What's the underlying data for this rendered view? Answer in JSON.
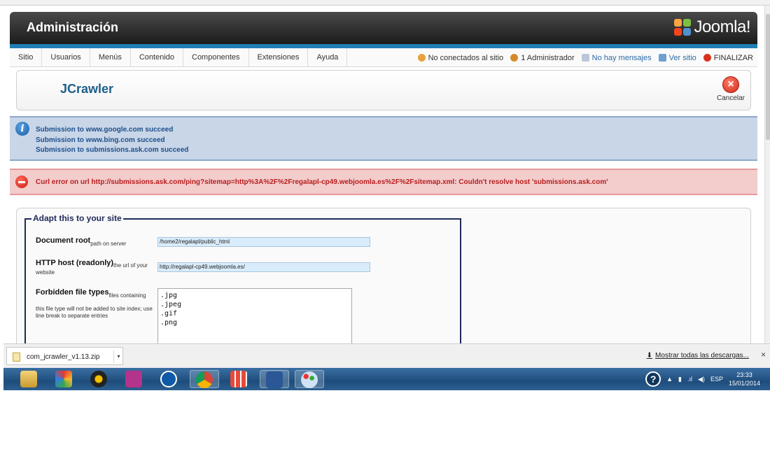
{
  "header": {
    "title": "Administración",
    "logo_text": "Joomla!"
  },
  "menu": {
    "items": [
      "Sitio",
      "Usuarios",
      "Menús",
      "Contenido",
      "Componentes",
      "Extensiones",
      "Ayuda"
    ]
  },
  "status": {
    "offline_users": "No conectados al sitio",
    "admins": "1 Administrador",
    "messages": "No hay mensajes",
    "view_site": "Ver sitio",
    "logout": "FINALIZAR"
  },
  "toolbar": {
    "title": "JCrawler",
    "cancel_label": "Cancelar"
  },
  "info_messages": [
    "Submission to www.google.com succeed",
    "Submission to www.bing.com succeed",
    "Submission to submissions.ask.com succeed"
  ],
  "error_message": "Curl error on url http://submissions.ask.com/ping?sitemap=http%3A%2F%2Fregalapl-cp49.webjoomla.es%2F%2Fsitemap.xml: Couldn't resolve host 'submissions.ask.com'",
  "form": {
    "legend": "Adapt this to your site",
    "document_root": {
      "label": "Document root",
      "hint": "path on server",
      "value": "/home2/regalapl/public_html"
    },
    "http_host": {
      "label": "HTTP host (readonly)",
      "hint": "the url of your",
      "hint2": "website",
      "value": "http://regalapl-cp49.webjoomla.es/"
    },
    "forbidden": {
      "label": "Forbidden file types",
      "hint": "files containing",
      "hint2": "this file type will not be added to site index; use line break to separate entries",
      "value": ".jpg\n.jpeg\n.gif\n.png"
    }
  },
  "downloads": {
    "file_name": "com_jcrawler_v1.13.zip",
    "show_all": "Mostrar todas las descargas...",
    "close": "×"
  },
  "taskbar": {
    "language": "ESP",
    "time": "23:33",
    "date": "15/01/2014",
    "apps": [
      "explorer-icon",
      "game-icon",
      "media-icon",
      "wifi-app-icon",
      "hp-icon",
      "chrome-icon",
      "apps-grid-icon",
      "word-icon",
      "paint-icon"
    ],
    "colors": {
      "accent": "#1f7fb5",
      "info_bg": "#c9d6e8",
      "error_bg": "#f3cccc"
    }
  }
}
